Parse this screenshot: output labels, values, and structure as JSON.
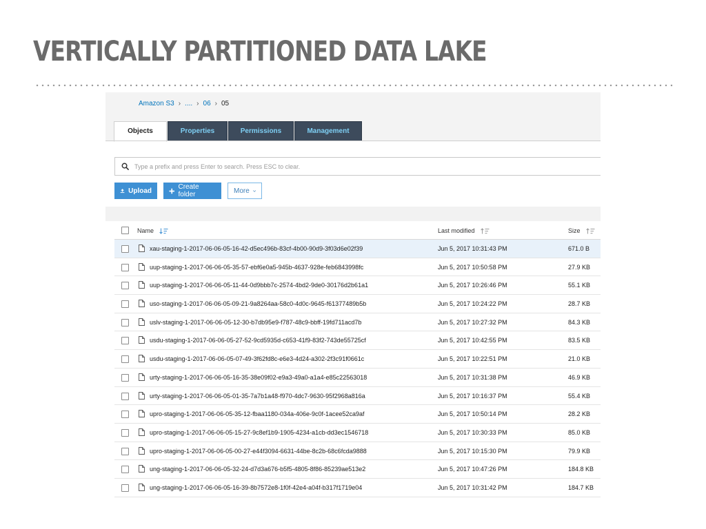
{
  "slide": {
    "title": "VERTICALLY PARTITIONED DATA LAKE"
  },
  "breadcrumb": [
    {
      "label": "Amazon S3",
      "link": true
    },
    {
      "label": "....",
      "link": true
    },
    {
      "label": "06",
      "link": true
    },
    {
      "label": "05",
      "link": false
    }
  ],
  "tabs": [
    {
      "label": "Objects",
      "active": true
    },
    {
      "label": "Properties",
      "active": false
    },
    {
      "label": "Permissions",
      "active": false
    },
    {
      "label": "Management",
      "active": false
    }
  ],
  "search": {
    "placeholder": "Type a prefix and press Enter to search. Press ESC to clear."
  },
  "toolbar": {
    "upload_label": "Upload",
    "create_folder_label": "Create folder",
    "more_label": "More"
  },
  "table": {
    "columns": {
      "name": "Name",
      "modified": "Last modified",
      "size": "Size"
    },
    "rows": [
      {
        "name": "xau-staging-1-2017-06-06-05-16-42-d5ec496b-83cf-4b00-90d9-3f03d6e02f39",
        "modified": "Jun 5, 2017 10:31:43 PM",
        "size": "671.0 B",
        "selected": true
      },
      {
        "name": "uup-staging-1-2017-06-06-05-35-57-ebf6e0a5-945b-4637-928e-feb6843998fc",
        "modified": "Jun 5, 2017 10:50:58 PM",
        "size": "27.9 KB"
      },
      {
        "name": "uup-staging-1-2017-06-06-05-11-44-0d9bbb7c-2574-4bd2-9de0-30176d2b61a1",
        "modified": "Jun 5, 2017 10:26:46 PM",
        "size": "55.1 KB"
      },
      {
        "name": "uso-staging-1-2017-06-06-05-09-21-9a8264aa-58c0-4d0c-9645-f61377489b5b",
        "modified": "Jun 5, 2017 10:24:22 PM",
        "size": "28.7 KB"
      },
      {
        "name": "uslv-staging-1-2017-06-06-05-12-30-b7db95e9-f787-48c9-bbff-19fd711acd7b",
        "modified": "Jun 5, 2017 10:27:32 PM",
        "size": "84.3 KB"
      },
      {
        "name": "usdu-staging-1-2017-06-06-05-27-52-9cd5935d-c653-41f9-83f2-743de55725cf",
        "modified": "Jun 5, 2017 10:42:55 PM",
        "size": "83.5 KB"
      },
      {
        "name": "usdu-staging-1-2017-06-06-05-07-49-3f62fd8c-e6e3-4d24-a302-2f3c91f0661c",
        "modified": "Jun 5, 2017 10:22:51 PM",
        "size": "21.0 KB"
      },
      {
        "name": "urty-staging-1-2017-06-06-05-16-35-38e09f02-e9a3-49a0-a1a4-e85c22563018",
        "modified": "Jun 5, 2017 10:31:38 PM",
        "size": "46.9 KB"
      },
      {
        "name": "urty-staging-1-2017-06-06-05-01-35-7a7b1a48-f970-4dc7-9630-95f2968a816a",
        "modified": "Jun 5, 2017 10:16:37 PM",
        "size": "55.4 KB"
      },
      {
        "name": "upro-staging-1-2017-06-06-05-35-12-fbaa1180-034a-406e-9c0f-1acee52ca9af",
        "modified": "Jun 5, 2017 10:50:14 PM",
        "size": "28.2 KB"
      },
      {
        "name": "upro-staging-1-2017-06-06-05-15-27-9c8ef1b9-1905-4234-a1cb-dd3ec1546718",
        "modified": "Jun 5, 2017 10:30:33 PM",
        "size": "85.0 KB"
      },
      {
        "name": "upro-staging-1-2017-06-06-05-00-27-e44f3094-6631-44be-8c2b-68c6fcda9888",
        "modified": "Jun 5, 2017 10:15:30 PM",
        "size": "79.9 KB"
      },
      {
        "name": "ung-staging-1-2017-06-06-05-32-24-d7d3a676-b5f5-4805-8f86-85239ae513e2",
        "modified": "Jun 5, 2017 10:47:26 PM",
        "size": "184.8 KB"
      },
      {
        "name": "ung-staging-1-2017-06-06-05-16-39-8b7572e8-1f0f-42e4-a04f-b317f1719e04",
        "modified": "Jun 5, 2017 10:31:42 PM",
        "size": "184.7 KB"
      }
    ]
  },
  "icons": {
    "search": "search-icon",
    "upload": "upload-icon",
    "create_folder": "plus-icon",
    "more": "chevron-down-icon",
    "file": "file-icon",
    "sort_name": "sort-descending-icon",
    "sort_idle": "sort-icon"
  },
  "colors": {
    "accent": "#3e90d4",
    "tab_dark": "#3d4b5c",
    "tab_text": "#7fd0f5",
    "selected_row": "#e8f1fa",
    "title_grey": "#6b6b6b"
  }
}
